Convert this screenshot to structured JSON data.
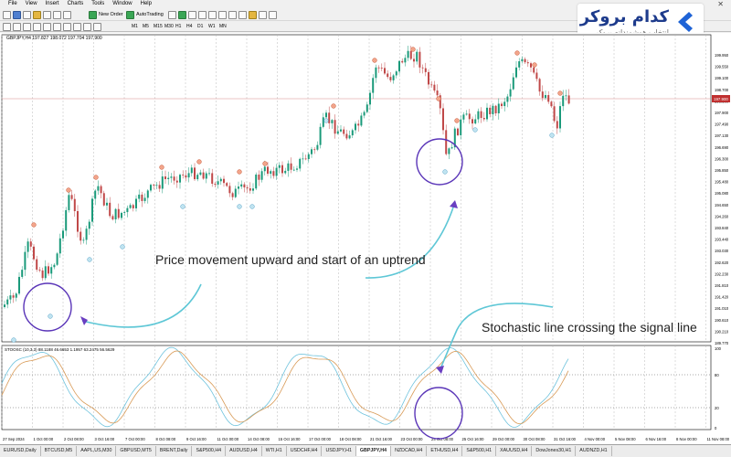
{
  "menu": [
    "File",
    "View",
    "Insert",
    "Charts",
    "Tools",
    "Window",
    "Help"
  ],
  "toolbar": {
    "new_order": "New Order",
    "autotrading": "AutoTrading"
  },
  "timeframes": [
    "M1",
    "M5",
    "M15",
    "M30",
    "H1",
    "H4",
    "D1",
    "W1",
    "MN"
  ],
  "logo": {
    "name": "کدام بروکر",
    "tagline": "انتخاب هوشمندانه بروکر"
  },
  "chart": {
    "symbol_info": "GBPJPY,H4 197.827 198.072 197.704 197.900",
    "price_labels": [
      "199.950",
      "199.550",
      "199.100",
      "198.700",
      "198.300",
      "197.900",
      "197.490",
      "197.130",
      "196.690",
      "196.300",
      "195.850",
      "195.480",
      "195.080",
      "194.650",
      "194.260",
      "193.840",
      "193.440",
      "193.030",
      "192.620",
      "192.230",
      "191.810",
      "191.420",
      "191.010",
      "190.610",
      "190.210",
      "189.770"
    ],
    "current_price": "197.900",
    "date_labels": [
      "27 Sep 2024",
      "1 Oct 00:00",
      "2 Oct 08:00",
      "3 Oct 16:00",
      "7 Oct 00:00",
      "8 Oct 08:00",
      "9 Oct 16:00",
      "11 Oct 00:00",
      "14 Oct 08:00",
      "15 Oct 16:00",
      "17 Oct 00:00",
      "18 Oct 08:00",
      "21 Oct 16:00",
      "23 Oct 00:00",
      "24 Oct 08:00",
      "25 Oct 16:00",
      "29 Oct 00:00",
      "30 Oct 08:00",
      "31 Oct 16:00",
      "4 Nov 00:00",
      "5 Nov 08:00",
      "6 Nov 16:00",
      "8 Nov 00:00",
      "11 Nov 08:00"
    ],
    "oscillator_label": "STOOSC (10,3,3) 88.1188 46.6653 1.1957 63.2475 56.5629",
    "osc_levels": [
      "80",
      "20"
    ],
    "osc_scale": [
      "100",
      "0"
    ]
  },
  "annotations": {
    "uptrend": "Price movement upward and start of an uptrend",
    "stochastic": "Stochastic line crossing the signal line"
  },
  "colors": {
    "bull": "#1a9a7a",
    "bear": "#c04848",
    "stoch": "#6fc3dd",
    "signal": "#d89a56",
    "accent_curve": "#5ec7d6",
    "accent_circle": "#6a3fc1"
  },
  "tabs": [
    "EURUSD,Daily",
    "BTCUSD,M5",
    "AAPL,US,M30",
    "GBPUSD,MT5",
    "BRENT,Daily",
    "S&P500,H4",
    "AUDUSD,H4",
    "WTI,H1",
    "USDCHF,H4",
    "USDJPY,H1",
    "GBPJPY,H4",
    "NZDCAD,H4",
    "ETHUSD,H4",
    "S&P500,H1",
    "XAUUSD,H4",
    "DowJones30,H1",
    "AUDNZD,H1"
  ],
  "active_tab": 10
}
